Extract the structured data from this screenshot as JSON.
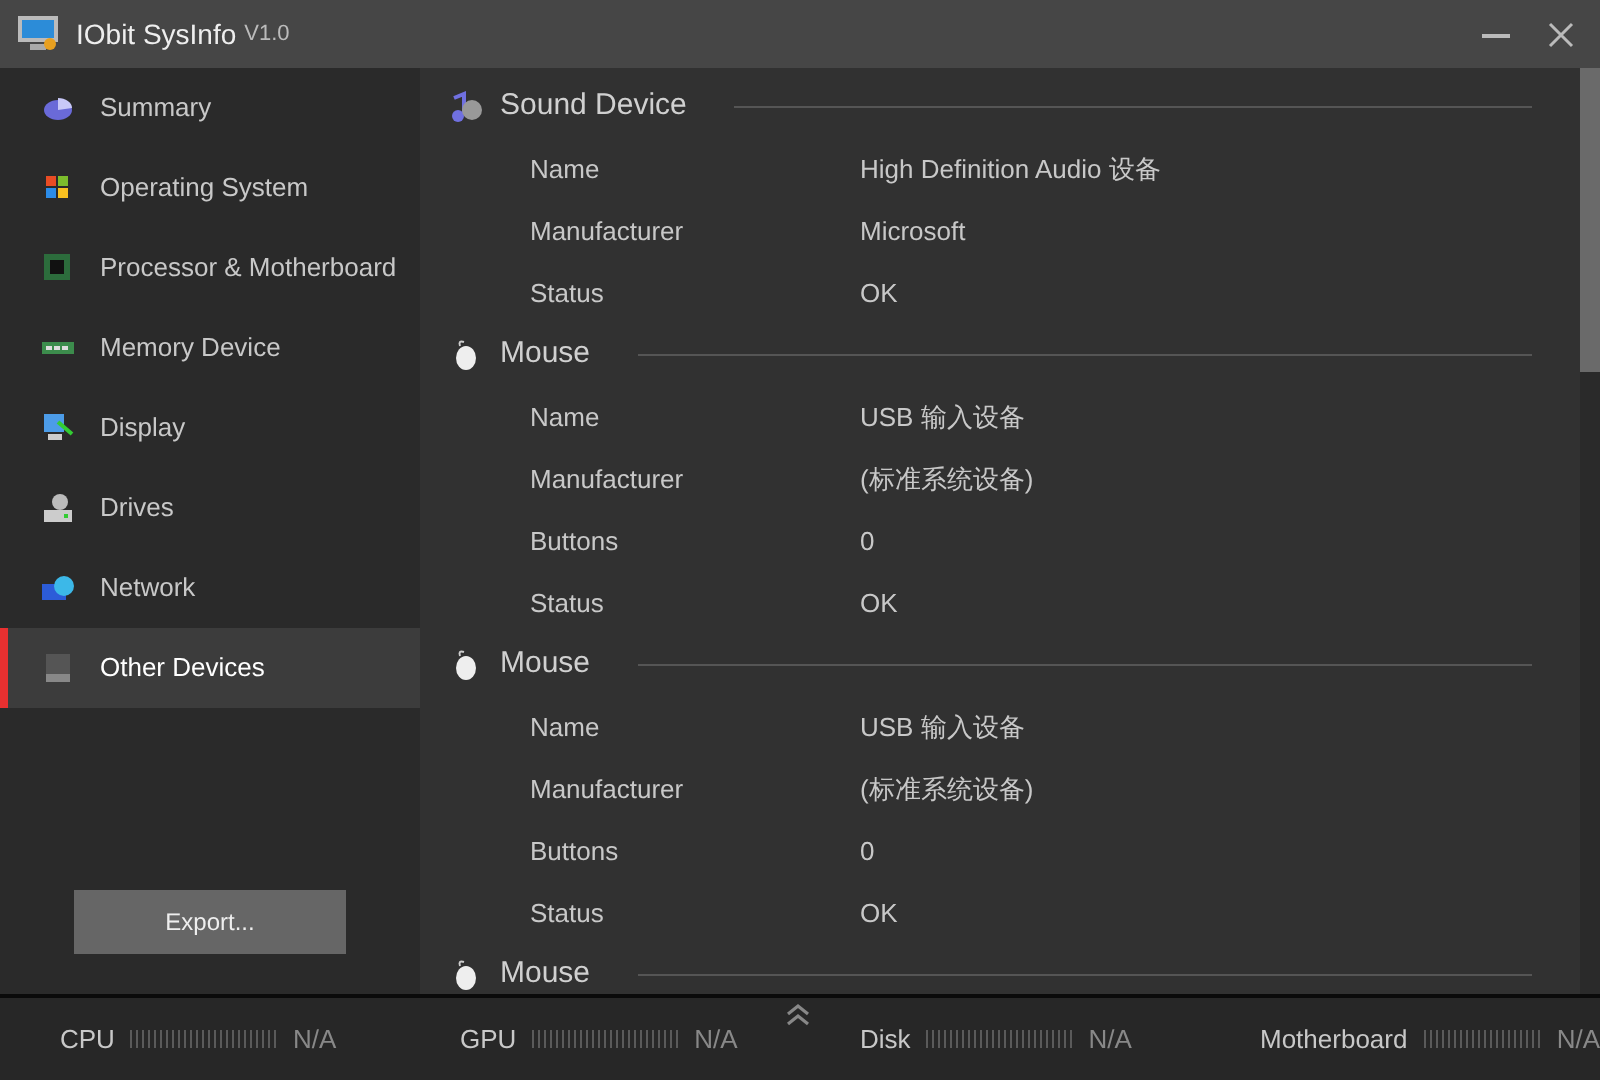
{
  "window": {
    "title": "IObit SysInfo",
    "version": "V1.0"
  },
  "sidebar": {
    "items": [
      {
        "label": "Summary",
        "kind": "summary",
        "selected": false
      },
      {
        "label": "Operating System",
        "kind": "os",
        "selected": false
      },
      {
        "label": "Processor & Motherboard",
        "kind": "chip",
        "selected": false
      },
      {
        "label": "Memory Device",
        "kind": "memory",
        "selected": false
      },
      {
        "label": "Display",
        "kind": "display",
        "selected": false
      },
      {
        "label": "Drives",
        "kind": "drive",
        "selected": false
      },
      {
        "label": "Network",
        "kind": "network",
        "selected": false
      },
      {
        "label": "Other Devices",
        "kind": "other",
        "selected": true
      }
    ],
    "export_button": "Export..."
  },
  "sections": [
    {
      "title": "Sound Device",
      "kind": "sound",
      "rows": [
        {
          "label": "Name",
          "value": "High Definition Audio 设备"
        },
        {
          "label": "Manufacturer",
          "value": "Microsoft"
        },
        {
          "label": "Status",
          "value": "OK"
        }
      ]
    },
    {
      "title": "Mouse",
      "kind": "mouse",
      "rows": [
        {
          "label": "Name",
          "value": "USB 输入设备"
        },
        {
          "label": "Manufacturer",
          "value": "(标准系统设备)"
        },
        {
          "label": "Buttons",
          "value": "0"
        },
        {
          "label": "Status",
          "value": "OK"
        }
      ]
    },
    {
      "title": "Mouse",
      "kind": "mouse",
      "rows": [
        {
          "label": "Name",
          "value": "USB 输入设备"
        },
        {
          "label": "Manufacturer",
          "value": "(标准系统设备)"
        },
        {
          "label": "Buttons",
          "value": "0"
        },
        {
          "label": "Status",
          "value": "OK"
        }
      ]
    },
    {
      "title": "Mouse",
      "kind": "mouse"
    }
  ],
  "status_bar": [
    {
      "label": "CPU",
      "reading": "N/A"
    },
    {
      "label": "GPU",
      "reading": "N/A"
    },
    {
      "label": "Disk",
      "reading": "N/A"
    },
    {
      "label": "Motherboard",
      "reading": "N/A"
    }
  ]
}
